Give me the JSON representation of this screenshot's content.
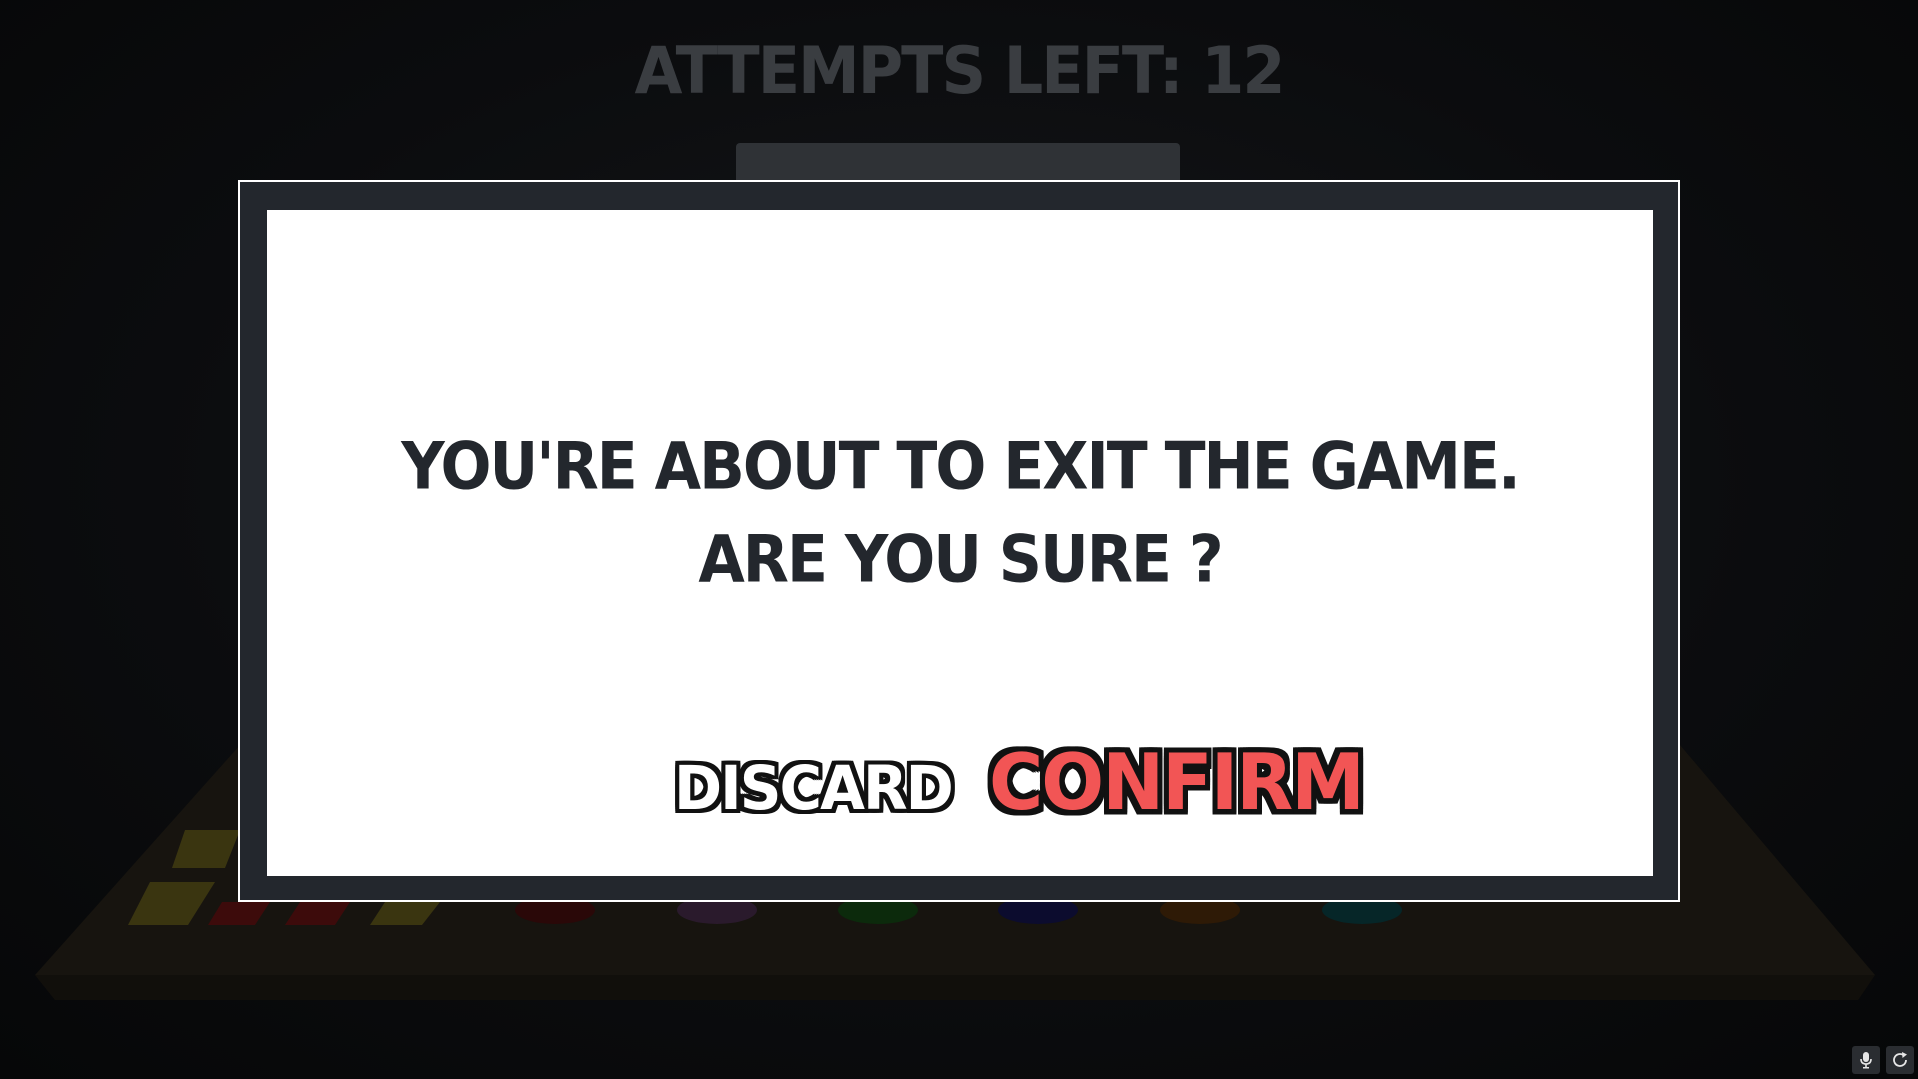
{
  "hud": {
    "attempts_text": "ATTEMPTS LEFT: 12"
  },
  "dialog": {
    "line1": "YOU'RE ABOUT TO EXIT THE GAME.",
    "line2": "ARE YOU SURE ?",
    "discard_label": "DISCARD",
    "confirm_label": "CONFIRM"
  },
  "colors": {
    "confirm_text": "#f25555",
    "dialog_text": "#23272d",
    "dialog_frame": "#23272d"
  },
  "corner_buttons": [
    {
      "icon": "microphone-icon"
    },
    {
      "icon": "reload-icon"
    }
  ]
}
